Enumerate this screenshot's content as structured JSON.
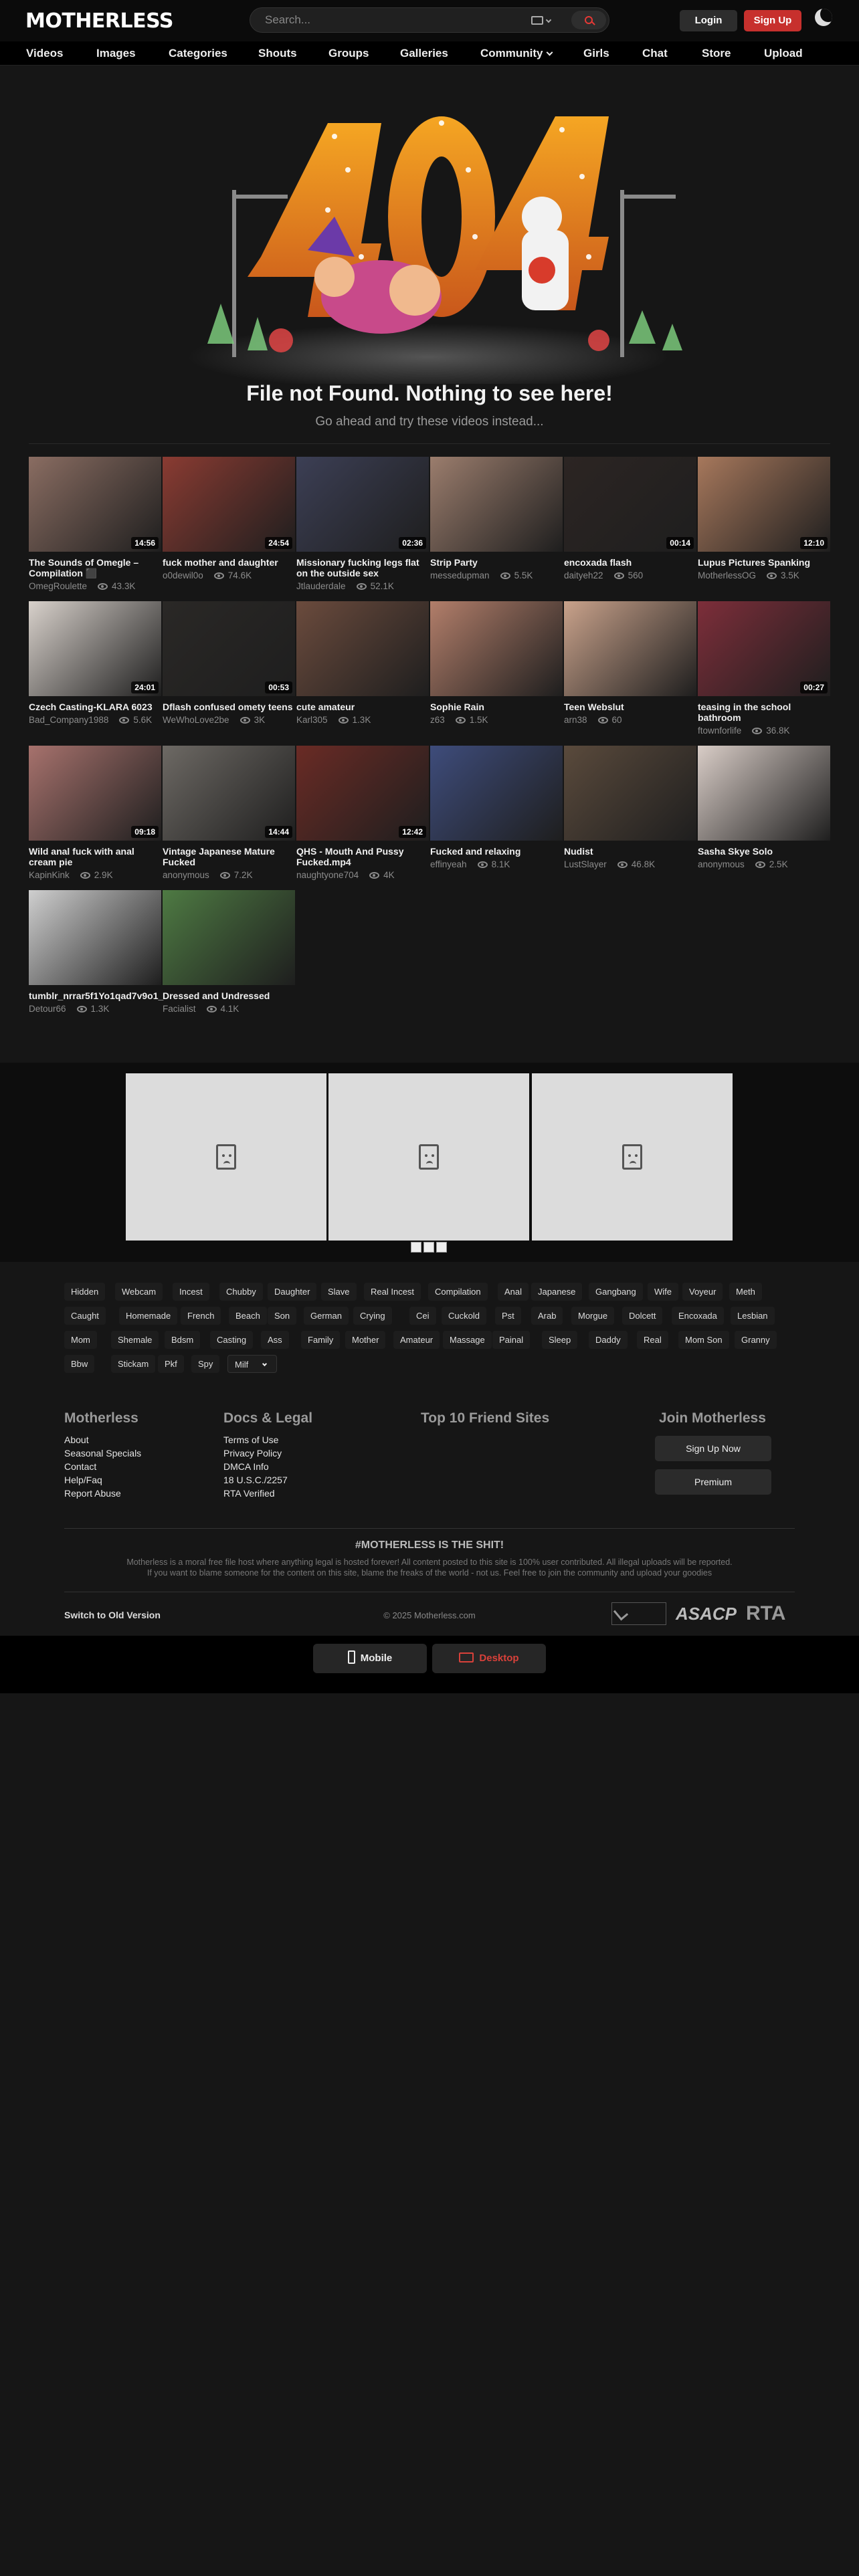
{
  "header": {
    "logo_text": "MOTHERLESS",
    "search_placeholder": "Search...",
    "login_label": "Login",
    "signup_label": "Sign Up"
  },
  "nav": [
    {
      "label": "Videos"
    },
    {
      "label": "Images"
    },
    {
      "label": "Categories"
    },
    {
      "label": "Shouts"
    },
    {
      "label": "Groups"
    },
    {
      "label": "Galleries"
    },
    {
      "label": "Community"
    },
    {
      "label": "Girls"
    },
    {
      "label": "Chat"
    },
    {
      "label": "Store"
    },
    {
      "label": "Upload"
    }
  ],
  "error": {
    "title": "File not Found. Nothing to see here!",
    "subtitle": "Go ahead and try these videos instead..."
  },
  "videos": [
    {
      "title": "The Sounds of Omegle – Compilation ⬛",
      "user": "OmegRoulette",
      "views": "43.3K",
      "duration": "14:56",
      "color": "#8a6d62"
    },
    {
      "title": "fuck mother and daughter",
      "user": "o0dewil0o",
      "views": "74.6K",
      "duration": "24:54",
      "color": "#8a3b32"
    },
    {
      "title": "Missionary fucking legs flat on the outside sex",
      "user": "Jtlauderdale",
      "views": "52.1K",
      "duration": "02:36",
      "color": "#3c3f55"
    },
    {
      "title": "Strip Party",
      "user": "messedupman",
      "views": "5.5K",
      "duration": "",
      "color": "#9b7d6d"
    },
    {
      "title": "encoxada flash",
      "user": "daityeh22",
      "views": "560",
      "duration": "00:14",
      "color": "#2c2523"
    },
    {
      "title": "Lupus Pictures Spanking",
      "user": "MotherlessOG",
      "views": "3.5K",
      "duration": "12:10",
      "color": "#a7785c"
    },
    {
      "title": "Czech Casting-KLARA 6023",
      "user": "Bad_Company1988",
      "views": "5.6K",
      "duration": "24:01",
      "color": "#d8d1cb"
    },
    {
      "title": "Dflash confused omety teens",
      "user": "WeWhoLove2be",
      "views": "3K",
      "duration": "00:53",
      "color": "#2a2826"
    },
    {
      "title": "cute amateur",
      "user": "Karl305",
      "views": "1.3K",
      "duration": "",
      "color": "#6b4b3d"
    },
    {
      "title": "Sophie Rain",
      "user": "z63",
      "views": "1.5K",
      "duration": "",
      "color": "#b27e6a"
    },
    {
      "title": "Teen Webslut",
      "user": "arn38",
      "views": "60",
      "duration": "",
      "color": "#c9a28b"
    },
    {
      "title": "teasing in the school bathroom",
      "user": "ftownforlife",
      "views": "36.8K",
      "duration": "00:27",
      "color": "#7d2e3a"
    },
    {
      "title": "Wild anal fuck with anal cream pie",
      "user": "KapinKink",
      "views": "2.9K",
      "duration": "09:18",
      "color": "#a7726d"
    },
    {
      "title": "Vintage Japanese Mature Fucked",
      "user": "anonymous",
      "views": "7.2K",
      "duration": "14:44",
      "color": "#6d6964"
    },
    {
      "title": "QHS - Mouth And Pussy Fucked.mp4",
      "user": "naughtyone704",
      "views": "4K",
      "duration": "12:42",
      "color": "#6a2b25"
    },
    {
      "title": "Fucked and relaxing",
      "user": "effinyeah",
      "views": "8.1K",
      "duration": "",
      "color": "#3e4c7b"
    },
    {
      "title": "Nudist",
      "user": "LustSlayer",
      "views": "46.8K",
      "duration": "",
      "color": "#5a4a3c"
    },
    {
      "title": "Sasha Skye Solo",
      "user": "anonymous",
      "views": "2.5K",
      "duration": "",
      "color": "#d9cdc7"
    },
    {
      "title": "tumblr_nrrar5f1Yo1qad7v9o1_",
      "user": "Detour66",
      "views": "1.3K",
      "duration": "",
      "color": "#cfcfcf"
    },
    {
      "title": "Dressed and Undressed",
      "user": "Facialist",
      "views": "4.1K",
      "duration": "",
      "color": "#4e7a43"
    }
  ],
  "tags": [
    [
      "Hidden",
      "Webcam",
      "Incest",
      "Chubby",
      "Daughter",
      "Slave",
      "Real Incest",
      "Compilation",
      "Anal",
      "Japanese",
      "Gangbang",
      "Wife",
      "Voyeur",
      "Meth"
    ],
    [
      "Caught",
      "Homemade",
      "French",
      "Beach",
      "Son",
      "German",
      "Crying",
      "Cei",
      "Cuckold",
      "Pst",
      "Arab",
      "Morgue",
      "Dolcett",
      "Encoxada",
      "Lesbian"
    ],
    [
      "Mom",
      "Shemale",
      "Bdsm",
      "Casting",
      "Ass",
      "Family",
      "Mother",
      "Amateur",
      "Massage",
      "Painal",
      "Sleep",
      "Daddy",
      "Real",
      "Mom Son",
      "Granny"
    ],
    [
      "Bbw",
      "Stickam",
      "Pkf",
      "Spy"
    ]
  ],
  "tag_select": "Milf",
  "footer": {
    "col1": {
      "head": "Motherless",
      "links": [
        "About",
        "Seasonal Specials",
        "Contact",
        "Help/Faq",
        "Report Abuse"
      ]
    },
    "col2": {
      "head": "Docs & Legal",
      "links": [
        "Terms of Use",
        "Privacy Policy",
        "DMCA Info",
        "18 U.S.C./2257",
        "RTA Verified"
      ]
    },
    "col3": {
      "head": "Top 10 Friend Sites"
    },
    "col4": {
      "head": "Join Motherless",
      "btn1": "Sign Up Now",
      "btn2": "Premium"
    },
    "slogan": "#MOTHERLESS IS THE SHIT!",
    "disc1": "Motherless is a moral free file host where anything legal is hosted forever! All content posted to this site is 100% user contributed. All illegal uploads will be reported.",
    "disc2": "If you want to blame someone for the content on this site, blame the freaks of the world - not us. Feel free to join the community and upload your goodies",
    "old_version": "Switch to Old Version",
    "copyright": "© 2025 Motherless.com",
    "badge1": "ASACP",
    "badge2": "RTA",
    "mobile_label": "Mobile",
    "desktop_label": "Desktop"
  },
  "colors": {
    "accent": "#c7302d",
    "bg": "#161616"
  }
}
